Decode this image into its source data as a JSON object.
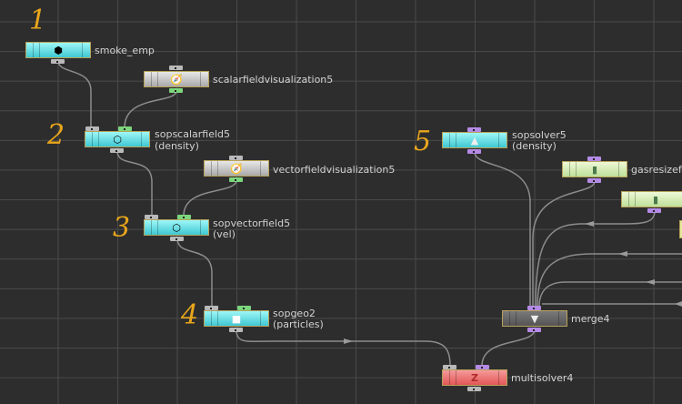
{
  "nodes": {
    "smoke_emp": {
      "name": "smoke_emp",
      "icon": "cube-icon"
    },
    "scalarvis": {
      "name": "scalarfieldvisualization5",
      "icon": "visualize-icon"
    },
    "sopscalar": {
      "name": "sopscalarfield5",
      "comment": "(density)",
      "icon": "scalar-field-icon"
    },
    "vectorvis": {
      "name": "vectorfieldvisualization5",
      "icon": "visualize-icon"
    },
    "sopvector": {
      "name": "sopvectorfield5",
      "comment": "(vel)",
      "icon": "vector-field-icon"
    },
    "sopgeo": {
      "name": "sopgeo2",
      "comment": "(particles)",
      "icon": "box-icon"
    },
    "sopsolver": {
      "name": "sopsolver5",
      "comment": "(density)",
      "icon": "solver-icon"
    },
    "gasresize": {
      "name": "gasresizef",
      "icon": "bottle-icon"
    },
    "gasnode2": {
      "icon": "bottle-icon"
    },
    "merge": {
      "name": "merge4",
      "icon": "funnel-icon"
    },
    "multisolver": {
      "name": "multisolver4",
      "icon": "z-icon"
    }
  },
  "annotations": [
    "1",
    "2",
    "3",
    "4",
    "5"
  ],
  "colors": {
    "sop_node": "#3fc7d2",
    "vis_node": "#a9a9a9",
    "gas_node": "#bfe09a",
    "multisolver": "#e35757",
    "annotation": "#e9a61c",
    "wire": "#8c8c8c"
  }
}
